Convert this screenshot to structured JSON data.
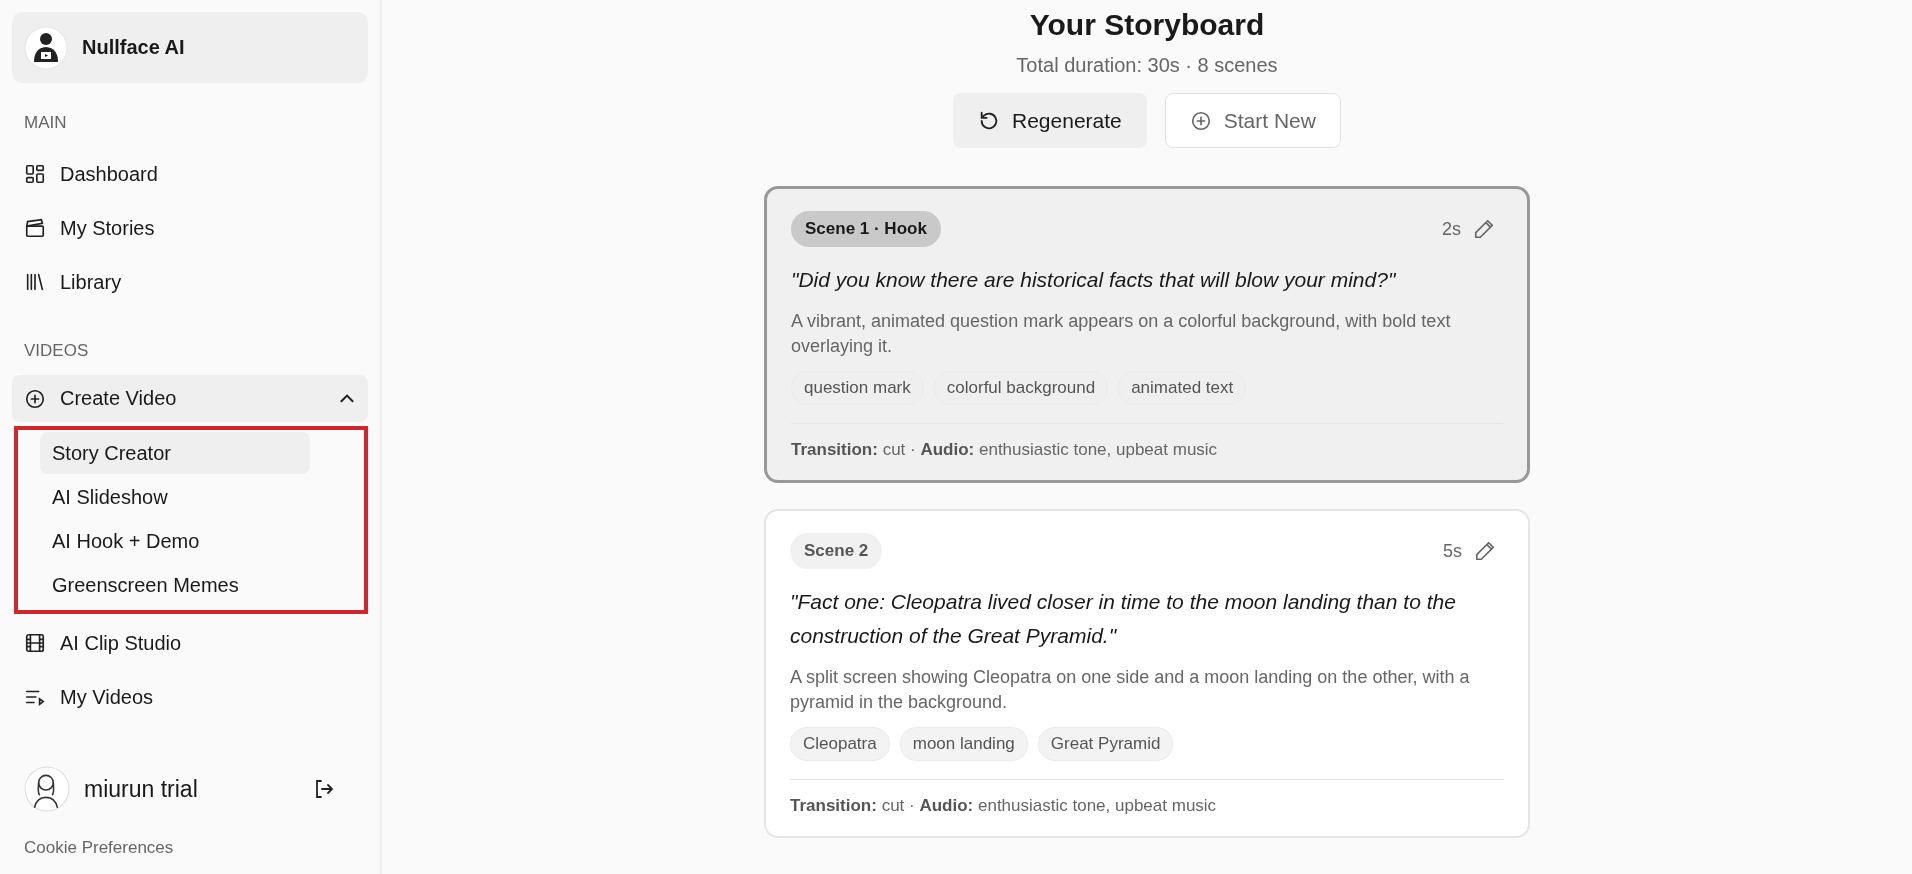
{
  "brand": {
    "name": "Nullface AI"
  },
  "sidebar": {
    "sections": [
      {
        "heading": "MAIN",
        "items": [
          {
            "label": "Dashboard",
            "selected": false
          },
          {
            "label": "My Stories",
            "selected": false
          },
          {
            "label": "Library",
            "selected": false
          }
        ]
      },
      {
        "heading": "VIDEOS",
        "items": [
          {
            "label": "Create Video",
            "selected": false,
            "expanded": true,
            "annotated": true,
            "children": [
              {
                "label": "Story Creator",
                "selected": true
              },
              {
                "label": "AI Slideshow",
                "selected": false
              },
              {
                "label": "AI Hook + Demo",
                "selected": false
              },
              {
                "label": "Greenscreen Memes",
                "selected": false
              }
            ]
          },
          {
            "label": "AI Clip Studio",
            "selected": false
          },
          {
            "label": "My Videos",
            "selected": false
          }
        ]
      }
    ]
  },
  "user": {
    "name": "miurun trial"
  },
  "footer_link": "Cookie Preferences",
  "header": {
    "title": "Your Storyboard",
    "subtitle": "Total duration: 30s · 8 scenes",
    "buttons": [
      {
        "label": "Regenerate",
        "kind": "primary"
      },
      {
        "label": "Start New",
        "kind": "outline"
      }
    ]
  },
  "scenes": [
    {
      "badge": "Scene 1 · Hook",
      "duration": "2s",
      "selected": true,
      "quote": "\"Did you know there are historical facts that will blow your mind?\"",
      "description": "A vibrant, animated question mark appears on a colorful background, with bold text overlaying it.",
      "tags": [
        "question mark",
        "colorful background",
        "animated text"
      ],
      "meta": "**Transition:** cut · **Audio:** enthusiastic tone, upbeat music"
    },
    {
      "badge": "Scene 2",
      "duration": "5s",
      "selected": false,
      "quote": "\"Fact one: Cleopatra lived closer in time to the moon landing than to the construction of the Great Pyramid.\"",
      "description": "A split screen showing Cleopatra on one side and a moon landing on the other, with a pyramid in the background.",
      "tags": [
        "Cleopatra",
        "moon landing",
        "Great Pyramid"
      ],
      "meta": "**Transition:** cut · **Audio:** enthusiastic tone, upbeat music"
    }
  ]
}
